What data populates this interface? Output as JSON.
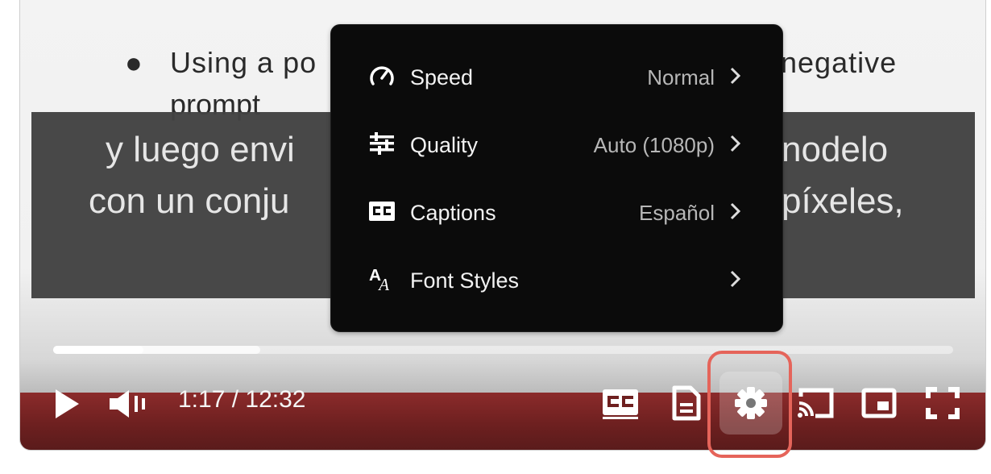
{
  "slide": {
    "bullet": "●",
    "text_left": "Using a po",
    "text_right": "negative",
    "text_line2": "prompt"
  },
  "captions": {
    "line1_left": "y luego envi",
    "line1_right": "nodelo",
    "line2_left": "con un conju",
    "line2_right": "píxeles,"
  },
  "player": {
    "time": "1:17 / 12:32",
    "progress_played_fraction": 0.1,
    "progress_buffered_fraction": 0.23
  },
  "settings_menu": {
    "items": [
      {
        "label": "Speed",
        "value": "Normal",
        "icon": "speedometer-icon"
      },
      {
        "label": "Quality",
        "value": "Auto (1080p)",
        "icon": "sliders-icon"
      },
      {
        "label": "Captions",
        "value": "Español",
        "icon": "cc-icon"
      },
      {
        "label": "Font Styles",
        "value": "",
        "icon": "font-style-icon"
      }
    ]
  },
  "colors": {
    "highlight": "#e5645a",
    "bar": "#6e2020",
    "menu_bg": "#0b0b0b"
  }
}
